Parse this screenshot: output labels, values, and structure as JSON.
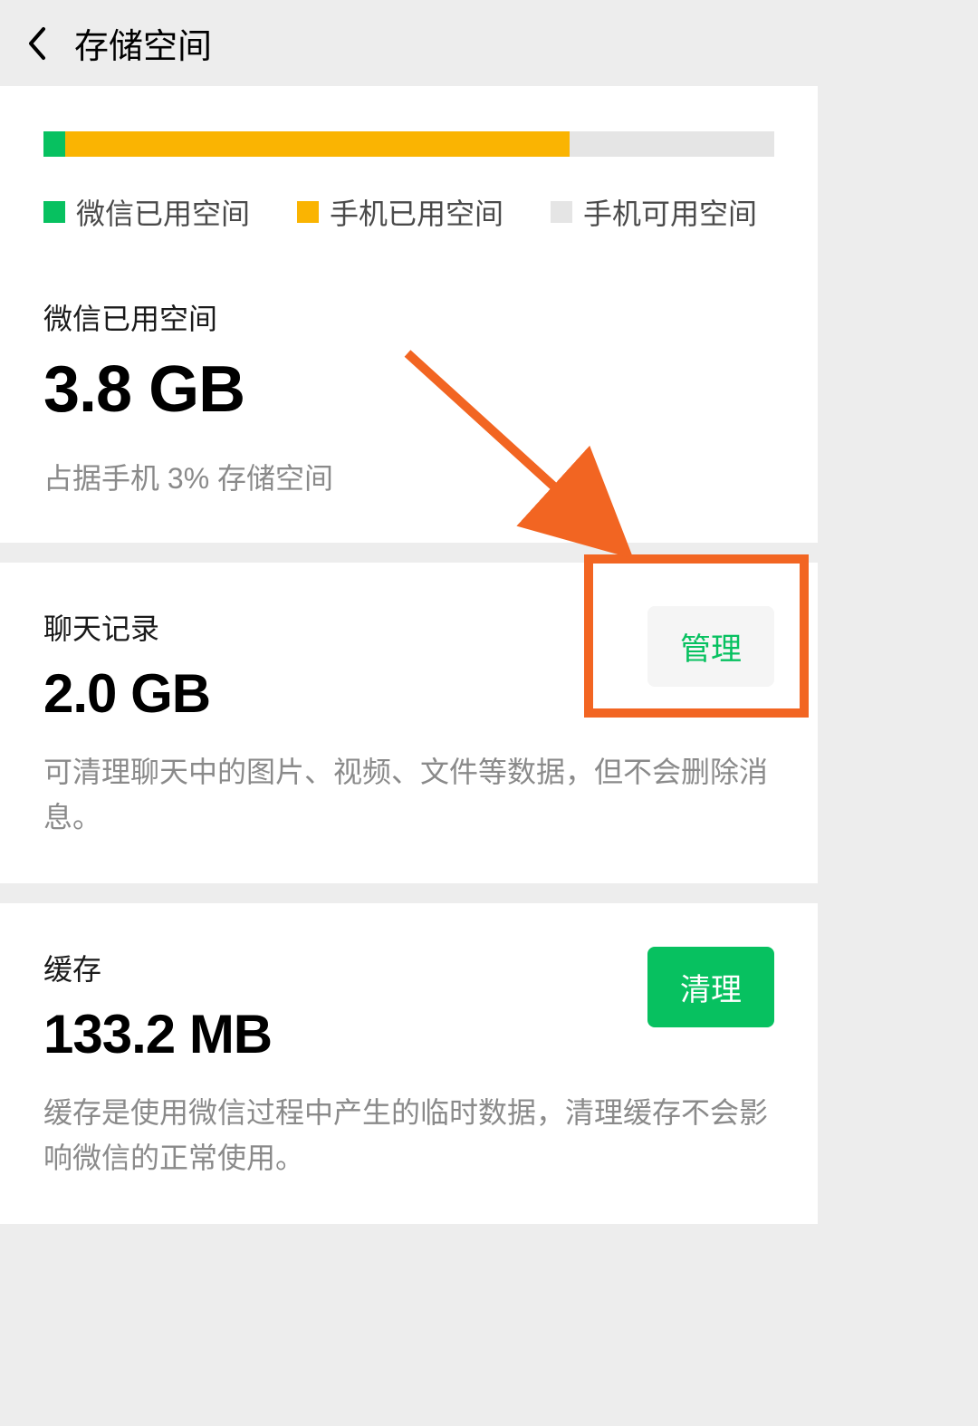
{
  "header": {
    "title": "存储空间"
  },
  "storage_bar": {
    "wechat_pct": 3,
    "phone_used_pct": 72,
    "legend": {
      "wechat": "微信已用空间",
      "phone_used": "手机已用空间",
      "phone_free": "手机可用空间"
    },
    "colors": {
      "wechat": "#07c160",
      "phone_used": "#fab402",
      "phone_free": "#e5e5e5"
    }
  },
  "wechat_storage": {
    "label": "微信已用空间",
    "value": "3.8 GB",
    "sub": "占据手机 3% 存储空间"
  },
  "chat_records": {
    "label": "聊天记录",
    "value": "2.0 GB",
    "desc": "可清理聊天中的图片、视频、文件等数据，但不会删除消息。",
    "button": "管理"
  },
  "cache": {
    "label": "缓存",
    "value": "133.2 MB",
    "desc": "缓存是使用微信过程中产生的临时数据，清理缓存不会影响微信的正常使用。",
    "button": "清理"
  },
  "annotation": {
    "highlight_color": "#f26522"
  }
}
